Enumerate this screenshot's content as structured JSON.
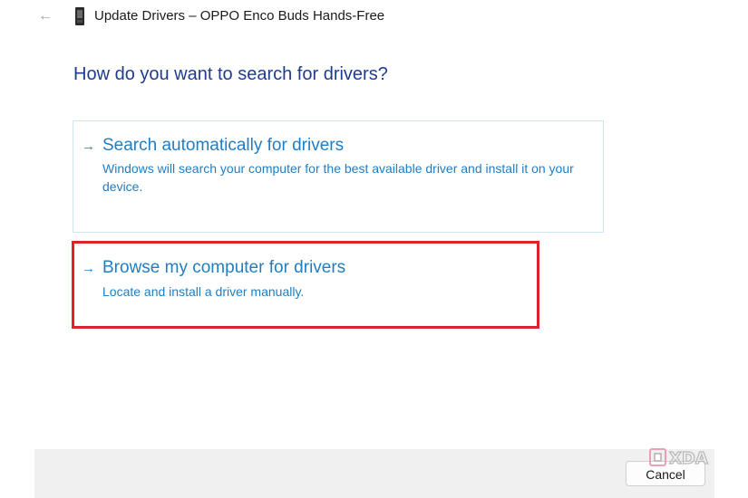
{
  "window": {
    "title": "Update Drivers – OPPO Enco Buds Hands-Free",
    "back_icon": "back-arrow-icon",
    "device_icon": "device-icon"
  },
  "main": {
    "heading": "How do you want to search for drivers?",
    "options": [
      {
        "arrow": "→",
        "title": "Search automatically for drivers",
        "description": "Windows will search your computer for the best available driver and install it on your device."
      },
      {
        "arrow": "→",
        "title": "Browse my computer for drivers",
        "description": "Locate and install a driver manually."
      }
    ]
  },
  "footer": {
    "cancel_label": "Cancel"
  },
  "watermark": {
    "text": "XDA"
  },
  "colors": {
    "heading": "#1f3d8f",
    "link": "#1f7ec4",
    "highlight": "#e0202a",
    "card_border": "#cfe6f2",
    "footer_bg": "#f0f0f0"
  }
}
